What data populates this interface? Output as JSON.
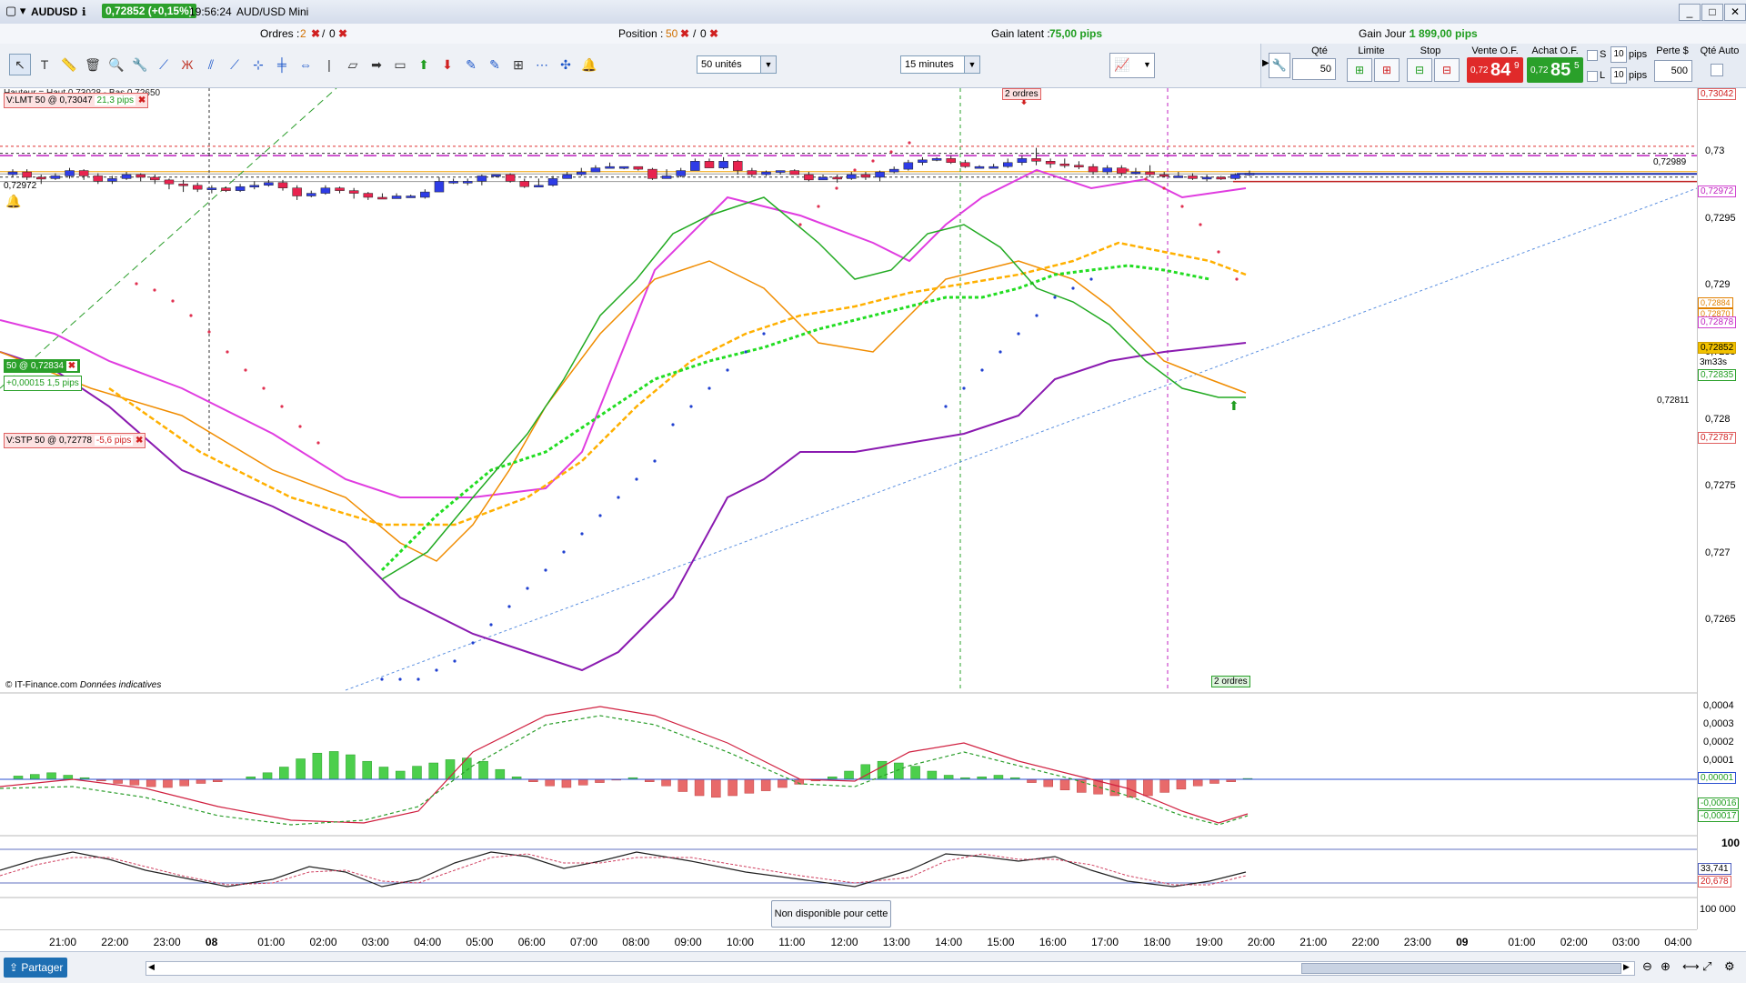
{
  "window": {
    "symbol": "AUDUSD",
    "price_badge": "0,72852 (+0,15%)",
    "time": "19:56:24",
    "title": "AUD/USD Mini"
  },
  "info": {
    "orders_label": "Ordres :",
    "orders_a": "2",
    "orders_b": "0",
    "position_label": "Position :",
    "position_a": "50",
    "position_b": "0",
    "gain_latent_label": "Gain latent :",
    "gain_latent_value": "75,00 pips",
    "gain_jour_label": "Gain Jour :",
    "gain_jour_value": "1 899,00 pips"
  },
  "toolbar": {
    "units": "50 unités",
    "timeframe": "15 minutes"
  },
  "order_panel": {
    "qte_label": "Qté",
    "qte_value": "50",
    "limite_label": "Limite",
    "stop_label": "Stop",
    "vente_label": "Vente O.F.",
    "vente_small": "0,72",
    "vente_big": "84",
    "vente_sup": "9",
    "achat_label": "Achat O.F.",
    "achat_small": "0,72",
    "achat_big": "85",
    "achat_sup": "5",
    "s_label": "S",
    "l_label": "L",
    "s_value": "10",
    "l_value": "10",
    "pips_s": "pips",
    "pips_l": "pips",
    "perte_label": "Perte $",
    "perte_value": "500",
    "qte_auto_label": "Qté Auto"
  },
  "chart": {
    "header": "Hauteur = Haut 0,73028 - Bas 0,72650",
    "lmt_order": "V:LMT 50 @ 0,73047",
    "lmt_pips": "21,3 pips",
    "position_box": "50 @ 0,72834",
    "position_gain": "+0,00015",
    "position_pips": "1,5 pips",
    "stp_order": "V:STP 50 @ 0,72778",
    "stp_pips": "-5,6 pips",
    "alert_level": "0,72972",
    "level_0_72989": "0,72989",
    "level_0_72811": "0,72811",
    "orders_marker_top": "2 ordres",
    "orders_marker_bottom": "2 ordres",
    "source": "© IT-Finance.com",
    "source_note": "Données indicatives",
    "unavailable": "Non disponible pour cette valeur"
  },
  "y_axis_main": [
    "0,73",
    "0,7295",
    "0,729",
    "0,7285",
    "0,728",
    "0,7275",
    "0,727",
    "0,7265"
  ],
  "y_tags": {
    "t1": "0,73042",
    "t2": "0,72972",
    "t3": "0,72884",
    "t4": "0,72870",
    "t5": "0,72878",
    "t6": "0,72852",
    "t7": "3m33s",
    "t8": "0,72835",
    "t9": "0,72787"
  },
  "y_axis_macd": [
    "0,0004",
    "0,0003",
    "0,0002",
    "0,0001"
  ],
  "macd_tags": {
    "m1": "0,00001",
    "m2": "-0,00016",
    "m3": "-0,00017"
  },
  "y_axis_stoch": {
    "top": "100",
    "v1": "33,741",
    "v2": "20,678"
  },
  "y_axis_vol": "100 000",
  "x_axis": [
    "21:00",
    "22:00",
    "23:00",
    "08",
    "01:00",
    "02:00",
    "03:00",
    "04:00",
    "05:00",
    "06:00",
    "07:00",
    "08:00",
    "09:00",
    "10:00",
    "11:00",
    "12:00",
    "13:00",
    "14:00",
    "15:00",
    "16:00",
    "17:00",
    "18:00",
    "19:00",
    "20:00",
    "21:00",
    "22:00",
    "23:00",
    "09",
    "01:00",
    "02:00",
    "03:00",
    "04:00"
  ],
  "footer": {
    "share": "Partager"
  },
  "colors": {
    "bull": "#2e3ce6",
    "bear": "#e8234f",
    "sell": "#e02a2a",
    "buy": "#2aa02a"
  }
}
